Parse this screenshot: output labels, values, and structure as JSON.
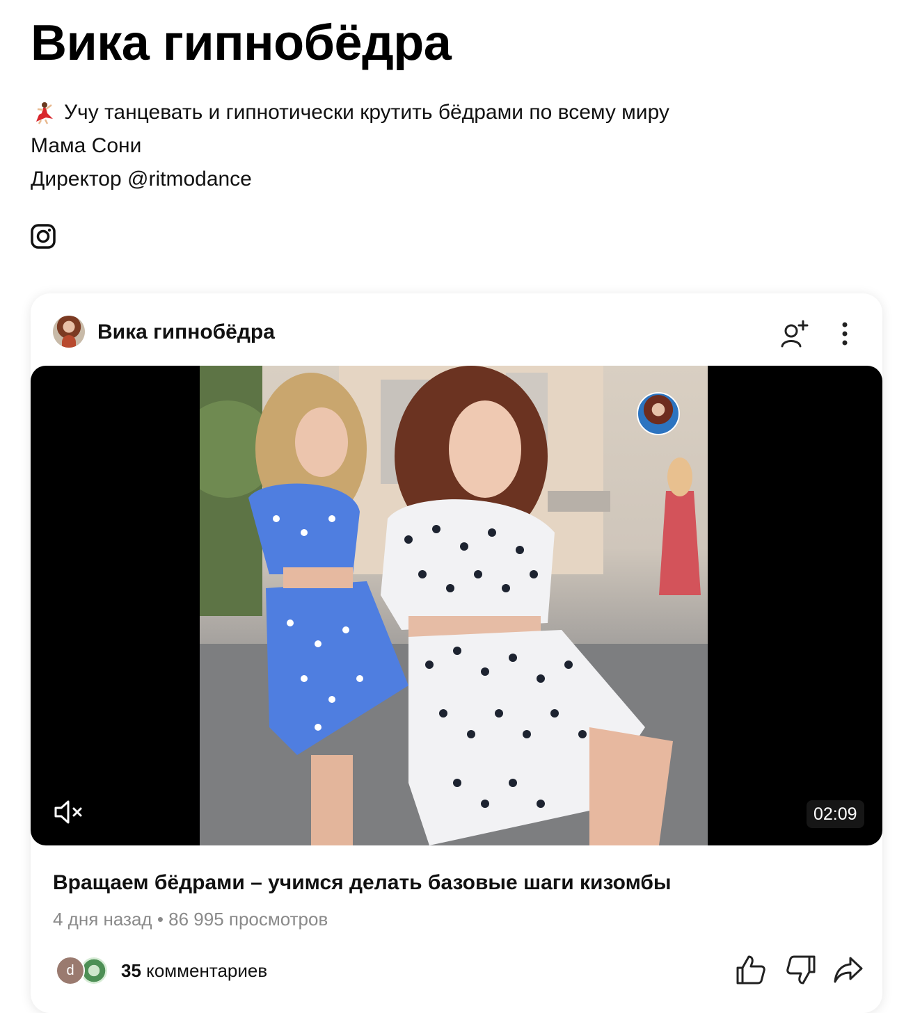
{
  "profile": {
    "name": "Вика гипнобёдра",
    "bio": [
      "Учу танцевать и гипнотически крутить бёдрами по всему миру",
      "Мама Сони",
      "Директор @ritmodance"
    ]
  },
  "card": {
    "channel_name": "Вика гипнобёдра",
    "video": {
      "duration": "02:09",
      "muted": true
    },
    "title": "Вращаем бёдрами – учимся делать базовые шаги кизомбы",
    "meta": "4 дня назад • 86 995 просмотров",
    "comments": {
      "avatar_letter": "d",
      "count": "35",
      "label": "комментариев"
    }
  },
  "icons": [
    "dancer-emoji-icon",
    "instagram-icon",
    "subscribe-icon",
    "more-vertical-icon",
    "mute-icon",
    "like-icon",
    "dislike-icon",
    "share-icon"
  ]
}
